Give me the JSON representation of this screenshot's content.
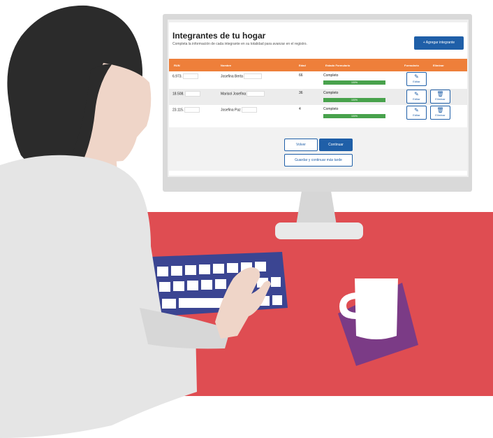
{
  "colors": {
    "brand_blue": "#1f5fa8",
    "header_orange": "#ee7f3a",
    "progress_green": "#48a24c",
    "desk_red": "#df4d52",
    "keyboard_navy": "#3b4592",
    "coaster_purple": "#7b3b86",
    "hair_dark": "#2b2b2b",
    "skin": "#efd5c8",
    "shirt_grey": "#e5e5e5",
    "monitor_grey": "#e8e8e8"
  },
  "page": {
    "title": "Integrantes de tu hogar",
    "subtitle": "Completa la información de cada integrante en su totalidad para avanzar en el registro.",
    "add_button": "+ Agregar integrante"
  },
  "table": {
    "columns": [
      "RUN",
      "Nombre",
      "Edad",
      "Estado Formulario",
      "Formulario",
      "Eliminar"
    ],
    "rows": [
      {
        "run": "6.973.",
        "name": "Josefina Berta",
        "age": "66",
        "status": "Completo",
        "progress_label": "100%",
        "progress": 1.0,
        "edit": "Editar",
        "delete": ""
      },
      {
        "run": "18.508.",
        "name": "Marisol Josefina",
        "age": "36",
        "status": "Completo",
        "progress_label": "100%",
        "progress": 1.0,
        "edit": "Editar",
        "delete": "Eliminar"
      },
      {
        "run": "23.115.",
        "name": "Josefina Paz",
        "age": "4",
        "status": "Completo",
        "progress_label": "100%",
        "progress": 1.0,
        "edit": "Editar",
        "delete": "Eliminar"
      }
    ]
  },
  "actions": {
    "back": "Volver",
    "continue": "Continuar",
    "save_later": "Guardar y continuar más tarde"
  },
  "icons": {
    "edit": "pencil-icon",
    "delete": "trash-icon"
  }
}
